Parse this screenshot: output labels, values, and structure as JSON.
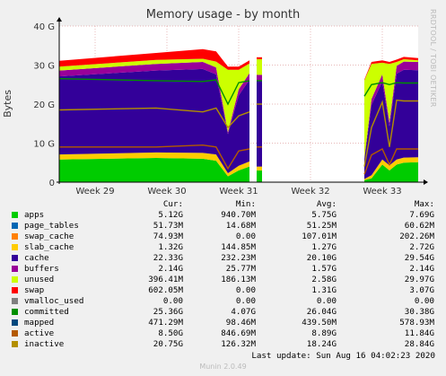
{
  "title": "Memory usage - by month",
  "side_text": "RRDTOOL / TOBI OETIKER",
  "ylabel": "Bytes",
  "legend_header": {
    "cur": "Cur:",
    "min": "Min:",
    "avg": "Avg:",
    "max": "Max:"
  },
  "legend": [
    {
      "name": "apps",
      "color": "#00cc00",
      "cur": "5.12G",
      "min": "940.70M",
      "avg": "5.75G",
      "max": "7.69G"
    },
    {
      "name": "page_tables",
      "color": "#0066b3",
      "cur": "51.73M",
      "min": "14.68M",
      "avg": "51.25M",
      "max": "60.62M"
    },
    {
      "name": "swap_cache",
      "color": "#ff8000",
      "cur": "74.93M",
      "min": "0.00",
      "avg": "107.01M",
      "max": "202.26M"
    },
    {
      "name": "slab_cache",
      "color": "#ffcc00",
      "cur": "1.32G",
      "min": "144.85M",
      "avg": "1.27G",
      "max": "2.72G"
    },
    {
      "name": "cache",
      "color": "#330099",
      "cur": "22.33G",
      "min": "232.23M",
      "avg": "20.10G",
      "max": "29.54G"
    },
    {
      "name": "buffers",
      "color": "#990099",
      "cur": "2.14G",
      "min": "25.77M",
      "avg": "1.57G",
      "max": "2.14G"
    },
    {
      "name": "unused",
      "color": "#ccff00",
      "cur": "396.41M",
      "min": "186.13M",
      "avg": "2.58G",
      "max": "29.97G"
    },
    {
      "name": "swap",
      "color": "#ff0000",
      "cur": "602.05M",
      "min": "0.00",
      "avg": "1.31G",
      "max": "3.07G"
    },
    {
      "name": "vmalloc_used",
      "color": "#808080",
      "cur": "0.00",
      "min": "0.00",
      "avg": "0.00",
      "max": "0.00"
    },
    {
      "name": "committed",
      "color": "#008f00",
      "cur": "25.36G",
      "min": "4.07G",
      "avg": "26.04G",
      "max": "30.38G"
    },
    {
      "name": "mapped",
      "color": "#00487d",
      "cur": "471.29M",
      "min": "98.46M",
      "avg": "439.50M",
      "max": "578.93M"
    },
    {
      "name": "active",
      "color": "#b35a00",
      "cur": "8.50G",
      "min": "846.69M",
      "avg": "8.89G",
      "max": "11.84G"
    },
    {
      "name": "inactive",
      "color": "#b38f00",
      "cur": "20.75G",
      "min": "126.32M",
      "avg": "18.24G",
      "max": "28.84G"
    }
  ],
  "footer": "Last update: Sun Aug 16 04:02:23 2020",
  "version": "Munin 2.0.49",
  "chart_data": {
    "type": "area",
    "stacked": true,
    "ylim": [
      0,
      40
    ],
    "yticks": [
      "0",
      "10 G",
      "20 G",
      "30 G",
      "40 G"
    ],
    "yvalues": [
      0,
      10,
      20,
      30,
      40
    ],
    "xticks": [
      "Week 29",
      "Week 30",
      "Week 31",
      "Week 32",
      "Week 33"
    ],
    "grid": true,
    "segments": [
      {
        "x": [
          0.0,
          0.27,
          0.4,
          0.437,
          0.47,
          0.5,
          0.53
        ],
        "apps": [
          5.8,
          6.2,
          6.0,
          5.5,
          1.5,
          3.0,
          4.0
        ],
        "slab_cache": [
          1.3,
          1.4,
          1.5,
          1.6,
          0.8,
          1.2,
          1.3
        ],
        "cache": [
          20.0,
          21.0,
          21.5,
          20.5,
          10.0,
          18.0,
          21.0
        ],
        "buffers": [
          1.5,
          1.7,
          1.8,
          1.8,
          0.5,
          1.6,
          1.6
        ],
        "unused": [
          1.0,
          1.0,
          0.8,
          1.5,
          16.0,
          5.0,
          2.5
        ],
        "swap": [
          1.5,
          1.8,
          2.5,
          2.6,
          0.8,
          0.8,
          0.8
        ],
        "committed": [
          26.5,
          26.0,
          25.8,
          26.2,
          20.0,
          25.5,
          26.0
        ],
        "active": [
          9.0,
          9.0,
          9.5,
          9.0,
          3.5,
          8.0,
          8.5
        ],
        "inactive": [
          18.5,
          19.0,
          18.0,
          19.0,
          14.0,
          17.0,
          18.0
        ]
      },
      {
        "x": [
          0.55,
          0.565
        ],
        "apps": [
          3.0,
          3.0
        ],
        "slab_cache": [
          1.0,
          1.0
        ],
        "cache": [
          22.0,
          22.0
        ],
        "buffers": [
          1.5,
          1.5
        ],
        "unused": [
          4.0,
          4.0
        ],
        "swap": [
          0.5,
          0.5
        ],
        "committed": [
          26.0,
          26.0
        ],
        "active": [
          9.0,
          9.0
        ],
        "inactive": [
          20.0,
          20.0
        ]
      },
      {
        "x": [
          0.85,
          0.87,
          0.9,
          0.92,
          0.94,
          0.96,
          1.0
        ],
        "apps": [
          0.5,
          1.0,
          4.5,
          3.0,
          4.5,
          5.0,
          5.1
        ],
        "slab_cache": [
          0.3,
          0.8,
          1.3,
          1.3,
          1.3,
          1.3,
          1.3
        ],
        "cache": [
          5.0,
          18.0,
          20.0,
          10.0,
          22.0,
          22.5,
          22.3
        ],
        "buffers": [
          0.3,
          1.5,
          1.8,
          1.0,
          2.0,
          2.1,
          2.1
        ],
        "unused": [
          20.0,
          9.0,
          3.0,
          15.0,
          1.0,
          0.6,
          0.4
        ],
        "swap": [
          0.2,
          0.5,
          0.6,
          0.5,
          0.6,
          0.6,
          0.6
        ],
        "committed": [
          22.0,
          25.0,
          25.5,
          25.0,
          25.5,
          25.4,
          25.4
        ],
        "active": [
          2.0,
          7.0,
          8.5,
          4.5,
          8.5,
          8.5,
          8.5
        ],
        "inactive": [
          4.0,
          14.0,
          20.5,
          9.0,
          21.0,
          20.8,
          20.8
        ]
      }
    ]
  }
}
